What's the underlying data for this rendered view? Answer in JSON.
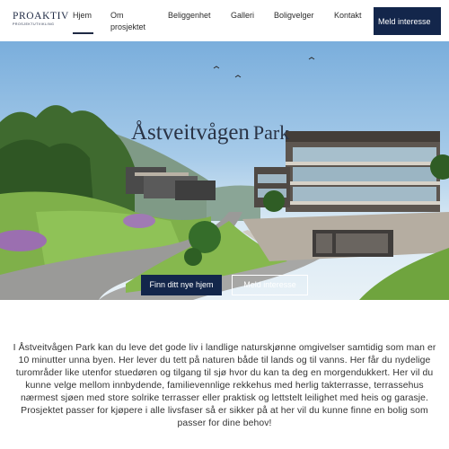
{
  "brand": {
    "name": "PROAKTIV",
    "tagline": "PROSJEKTUTVIKLING"
  },
  "nav": {
    "items": [
      {
        "label": "Hjem",
        "active": true
      },
      {
        "label": "Om prosjektet",
        "active": false
      },
      {
        "label": "Beliggenhet",
        "active": false
      },
      {
        "label": "Galleri",
        "active": false
      },
      {
        "label": "Boligvelger",
        "active": false
      },
      {
        "label": "Kontakt",
        "active": false
      }
    ],
    "cta_label": "Meld interesse"
  },
  "hero": {
    "title_part1": "Åstveitvågen",
    "title_part2": "Park",
    "primary_button": "Finn ditt nye hjem",
    "secondary_button": "Meld interesse"
  },
  "description": "I Åstveitvågen Park kan du leve det gode liv i landlige naturskjønne omgivelser samtidig som man er 10 minutter unna byen. Her lever du tett på naturen både til lands og til vanns. Her får du nydelige turområder like utenfor stuedøren og tilgang til sjø hvor du kan ta deg en morgendukkert. Her vil du kunne velge mellom innbydende, familievennlige rekkehus med herlig takterrasse, terrassehus nærmest sjøen med store solrike terrasser eller praktisk og lettstelt leilighet med heis og garasje. Prosjektet passer for kjøpere i alle livsfaser så er sikker på at her vil du kunne finne en bolig som passer for dine behov!",
  "colors": {
    "brand_navy": "#13264b",
    "text": "#333333"
  }
}
